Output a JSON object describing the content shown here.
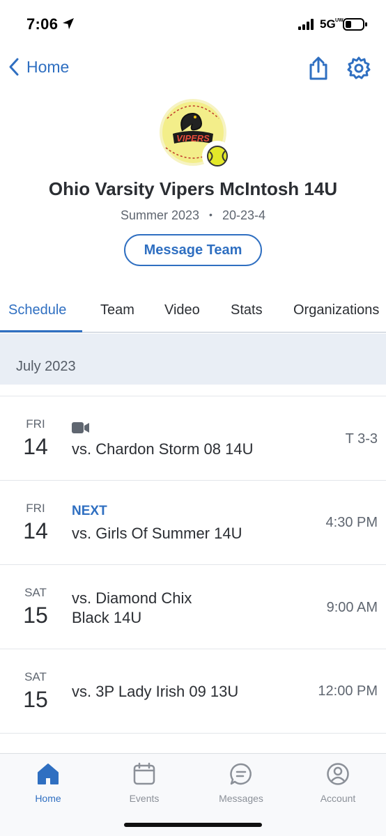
{
  "status_bar": {
    "time": "7:06",
    "network": "5G",
    "network_sub": "UW"
  },
  "nav": {
    "back_label": "Home"
  },
  "team": {
    "logo_text": "VIPERS",
    "name": "Ohio Varsity Vipers McIntosh 14U",
    "season": "Summer 2023",
    "record": "20-23-4",
    "message_button": "Message Team"
  },
  "tabs": [
    {
      "label": "Schedule",
      "active": true
    },
    {
      "label": "Team"
    },
    {
      "label": "Video"
    },
    {
      "label": "Stats"
    },
    {
      "label": "Organizations"
    }
  ],
  "schedule": {
    "month": "July 2023",
    "games": [
      {
        "day": "FRI",
        "date": "14",
        "opponent": "vs. Chardon Storm 08 14U",
        "result": "T 3-3",
        "has_video": true
      },
      {
        "day": "FRI",
        "date": "14",
        "badge": "NEXT",
        "opponent": "vs. Girls Of Summer 14U",
        "time": "4:30 PM"
      },
      {
        "day": "SAT",
        "date": "15",
        "opponent_line1": "vs. Diamond Chix",
        "opponent_line2": "Black 14U",
        "time": "9:00 AM"
      },
      {
        "day": "SAT",
        "date": "15",
        "opponent": "vs. 3P Lady Irish 09 13U",
        "time": "12:00 PM"
      }
    ]
  },
  "bottom_nav": [
    {
      "label": "Home",
      "icon": "home-icon",
      "active": true
    },
    {
      "label": "Events",
      "icon": "calendar-icon"
    },
    {
      "label": "Messages",
      "icon": "chat-icon"
    },
    {
      "label": "Account",
      "icon": "account-icon"
    }
  ],
  "colors": {
    "accent": "#2f6fc1",
    "text": "#2b2e33",
    "muted": "#5f6670",
    "month_bg": "#e9eef5"
  }
}
